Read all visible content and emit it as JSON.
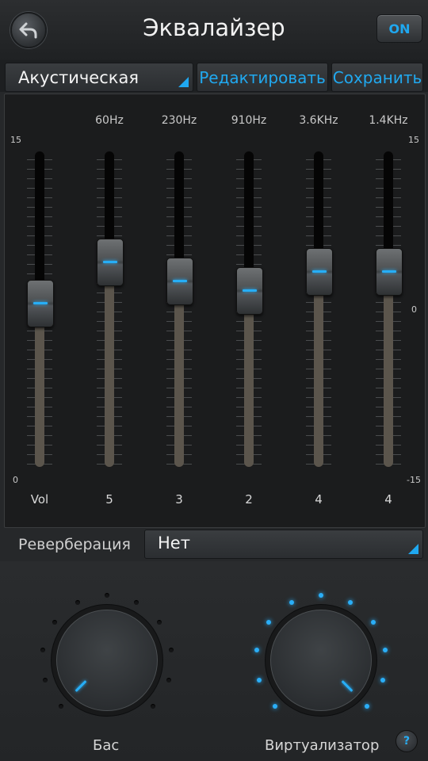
{
  "header": {
    "title": "Эквалайзер",
    "on_label": "ON",
    "back_icon": "back-arrow-icon"
  },
  "preset": {
    "selected": "Акустическая",
    "edit_label": "Редактировать",
    "save_label": "Сохранить"
  },
  "scale": {
    "left_top": "15",
    "left_bottom": "0",
    "right_top": "15",
    "right_mid": "0",
    "right_bottom": "-15"
  },
  "sliders": [
    {
      "freq": "",
      "value_label": "Vol",
      "level": 0.52
    },
    {
      "freq": "60Hz",
      "value_label": "5",
      "level": 0.65
    },
    {
      "freq": "230Hz",
      "value_label": "3",
      "level": 0.59
    },
    {
      "freq": "910Hz",
      "value_label": "2",
      "level": 0.56
    },
    {
      "freq": "3.6KHz",
      "value_label": "4",
      "level": 0.62
    },
    {
      "freq": "1.4KHz",
      "value_label": "4",
      "level": 0.62
    }
  ],
  "reverb": {
    "label": "Реверберация",
    "selected": "Нет"
  },
  "bass": {
    "label": "Бас",
    "level": 0.0
  },
  "virtualizer": {
    "label": "Виртуализатор",
    "level": 1.0
  },
  "help_label": "?",
  "colors": {
    "accent": "#27aef6",
    "background": "#26282a"
  }
}
